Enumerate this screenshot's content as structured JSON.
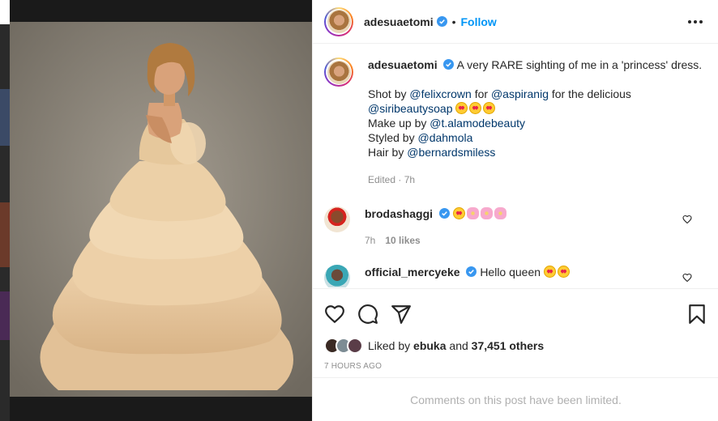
{
  "post": {
    "author": "adesuaetomi",
    "follow_label": "Follow",
    "separator": "•"
  },
  "caption": {
    "username": "adesuaetomi",
    "line1": "A very RARE sighting of me in a 'princess' dress.",
    "shot_by_prefix": "Shot by ",
    "shot_by_mention": "@felixcrown",
    "for_text": " for ",
    "for_mention": "@aspiranig",
    "delicious_text": " for the delicious",
    "brand_mention": "@siribeautysoap",
    "makeup_prefix": "Make up by ",
    "makeup_mention": "@t.alamodebeauty",
    "styled_prefix": "Styled by ",
    "styled_mention": "@dahmola",
    "hair_prefix": "Hair by ",
    "hair_mention": "@bernardsmiless",
    "edited": "Edited · 7h"
  },
  "comments": [
    {
      "username": "brodashaggi",
      "text": "",
      "time": "7h",
      "likes": "10 likes"
    },
    {
      "username": "official_mercyeke",
      "text": "Hello queen "
    }
  ],
  "actions": {
    "liked_by_prefix": "Liked by ",
    "liked_by_user": "ebuka",
    "liked_by_and": " and ",
    "liked_by_count": "37,451 others",
    "time_ago": "7 HOURS AGO"
  },
  "footer": {
    "limited_text": "Comments on this post have been limited."
  },
  "colors": {
    "link": "#00376b",
    "follow": "#0095f6",
    "verified": "#3897f0",
    "muted": "#8e8e8e"
  }
}
